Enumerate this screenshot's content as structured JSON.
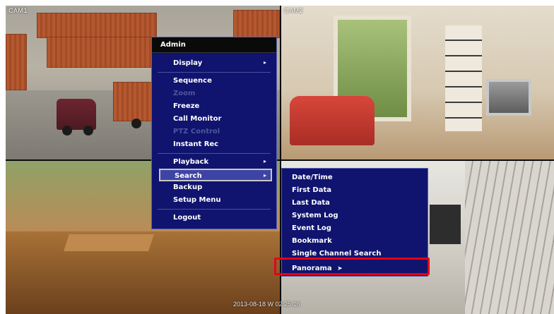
{
  "cameras": {
    "cam1_label": "CAM1",
    "cam2_label": "CAM2"
  },
  "timestamp": "2013-08-18 W 02:25:16",
  "main_menu": {
    "title": "Admin",
    "items": [
      {
        "label": "Display",
        "arrow": "▸"
      },
      {
        "label": "Sequence"
      },
      {
        "label": "Zoom"
      },
      {
        "label": "Freeze"
      },
      {
        "label": "Call Monitor"
      },
      {
        "label": "PTZ Control"
      },
      {
        "label": "Instant Rec"
      },
      {
        "label": "Playback",
        "arrow": "▸"
      },
      {
        "label": "Search",
        "arrow": "▸"
      },
      {
        "label": "Backup"
      },
      {
        "label": "Setup Menu"
      },
      {
        "label": "Logout"
      }
    ]
  },
  "sub_menu": {
    "items": [
      {
        "label": "Date/Time"
      },
      {
        "label": "First Data"
      },
      {
        "label": "Last Data"
      },
      {
        "label": "System Log"
      },
      {
        "label": "Event Log"
      },
      {
        "label": "Bookmark"
      },
      {
        "label": "Single Channel Search"
      },
      {
        "label": "Panorama"
      }
    ]
  },
  "colors": {
    "menu_bg": "#10146e",
    "highlight": "#e4001b"
  }
}
